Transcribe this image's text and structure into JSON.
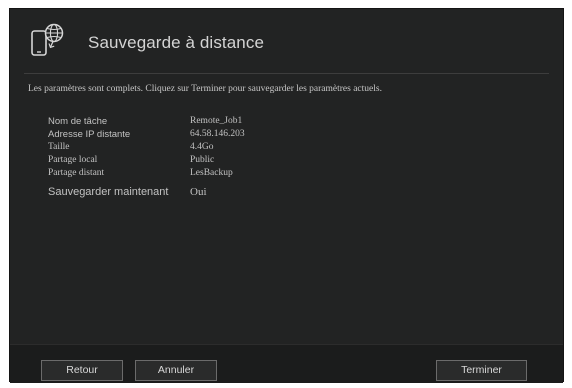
{
  "header": {
    "icon": "phone-globe-icon",
    "title": "Sauvegarde à distance"
  },
  "message": "Les paramètres sont complets. Cliquez sur Terminer pour sauvegarder les paramètres actuels.",
  "details": {
    "task_name": {
      "label": "Nom de tâche",
      "value": "Remote_Job1"
    },
    "remote_ip": {
      "label": "Adresse IP distante",
      "value": "64.58.146.203"
    },
    "size": {
      "label": "Taille",
      "value": "4.4Go"
    },
    "local_share": {
      "label": "Partage local",
      "value": "Public"
    },
    "remote_share": {
      "label": "Partage distant",
      "value": "LesBackup"
    },
    "backup_now": {
      "label": "Sauvegarder maintenant",
      "value": "Oui"
    }
  },
  "buttons": {
    "back": "Retour",
    "cancel": "Annuler",
    "finish": "Terminer"
  },
  "colors": {
    "panel": "#222323",
    "footer": "#1b1c1c",
    "text": "#c2c2c2"
  }
}
